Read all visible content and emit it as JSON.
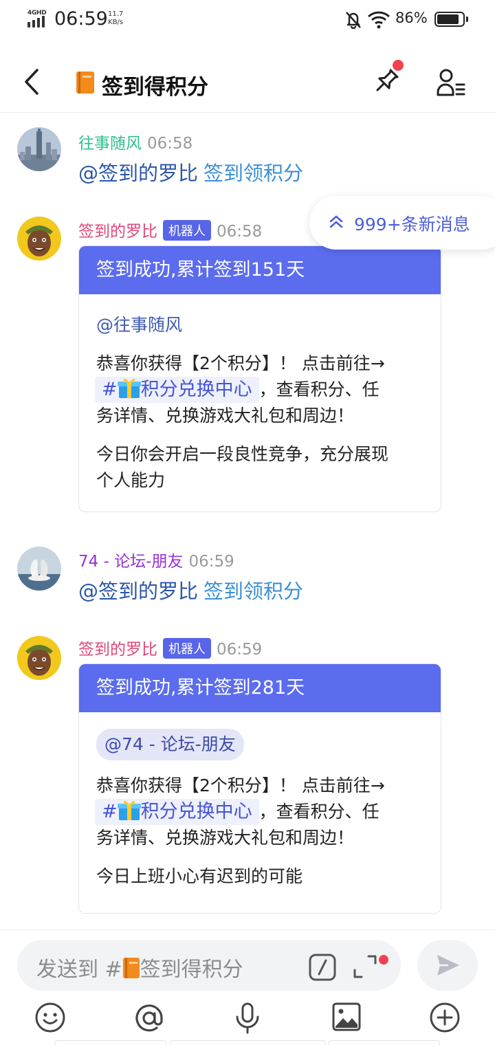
{
  "status": {
    "network": "4GHD",
    "time": "06:59",
    "speed_value": "11.7",
    "speed_unit": "KB/s",
    "battery": "86%",
    "battery_level": 0.86
  },
  "header": {
    "channel_name": "签到得积分"
  },
  "new_messages": "999+条新消息",
  "messages": [
    {
      "name": "往事随风",
      "time": "06:58",
      "mention": "@签到的罗比",
      "command": "签到领积分"
    },
    {
      "name": "签到的罗比",
      "badge": "机器人",
      "time": "06:58",
      "card_title": "签到成功,累计签到151天",
      "card_mention": "@往事随风",
      "line1_a": "恭喜你获得【2个积分】！ 点击前往→",
      "channel_link": "积分兑换中心",
      "line1_b": "，查看积分、任",
      "line1_c": "务详情、兑换游戏大礼包和周边！",
      "fortune_l1": "今日你会开启一段良性竞争，充分展现",
      "fortune_l2": "个人能力"
    },
    {
      "name": "74 - 论坛-朋友",
      "time": "06:59",
      "mention": "@签到的罗比",
      "command": "签到领积分"
    },
    {
      "name": "签到的罗比",
      "badge": "机器人",
      "time": "06:59",
      "card_title": "签到成功,累计签到281天",
      "card_mention": "@74 - 论坛-朋友",
      "line1_a": "恭喜你获得【2个积分】！ 点击前往→",
      "channel_link": "积分兑换中心",
      "line1_b": "，查看积分、任",
      "line1_c": "务详情、兑换游戏大礼包和周边！",
      "fortune_l1": "今日上班小心有迟到的可能"
    }
  ],
  "composer": {
    "placeholder_prefix": "发送到 #",
    "placeholder_channel": "签到得积分",
    "tools": [
      "emoji-icon",
      "mention-icon",
      "microphone-icon",
      "image-icon",
      "plus-icon"
    ]
  },
  "colors": {
    "accent": "#5b6cef",
    "user1_name": "#2fbf8f",
    "bot_name": "#e0457b",
    "user2_name": "#9b2fd6",
    "mention": "#2a56a8",
    "link": "#3a8fd8",
    "notification_dot": "#f2434d"
  }
}
